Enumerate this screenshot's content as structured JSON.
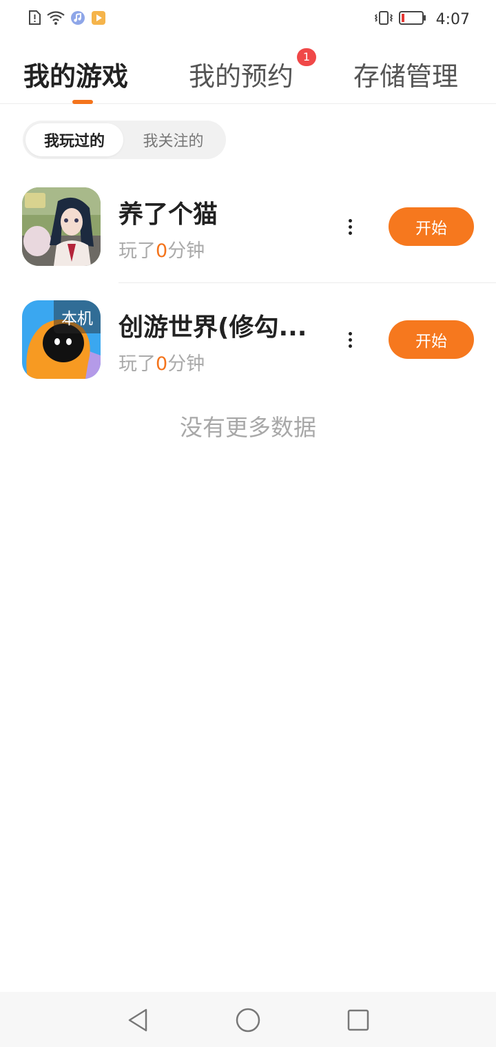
{
  "status_bar": {
    "time": "4:07",
    "left_icons": [
      "sim-alert-icon",
      "wifi-icon",
      "music-app-icon",
      "video-app-icon"
    ],
    "right_icons": [
      "vibrate-icon",
      "battery-low-icon"
    ],
    "battery_color": "#e53935"
  },
  "top_tabs": [
    {
      "label": "我的游戏",
      "active": true
    },
    {
      "label": "我的预约",
      "active": false,
      "badge": "1"
    },
    {
      "label": "存储管理",
      "active": false
    }
  ],
  "segment": {
    "items": [
      {
        "label": "我玩过的",
        "active": true
      },
      {
        "label": "我关注的",
        "active": false
      }
    ]
  },
  "games": [
    {
      "title": "养了个猫",
      "played_prefix": "玩了",
      "played_value": "0",
      "played_unit": "分钟",
      "action_label": "开始",
      "icon": "anime-girl-game-icon"
    },
    {
      "title": "创游世界(修勾...",
      "played_prefix": "玩了",
      "played_value": "0",
      "played_unit": "分钟",
      "action_label": "开始",
      "icon": "creation-world-game-icon",
      "badge": "本机"
    }
  ],
  "footer_text": "没有更多数据",
  "nav_bar": {
    "buttons": [
      "back-icon",
      "home-icon",
      "recents-icon"
    ]
  },
  "colors": {
    "accent": "#f6781e",
    "badge_red": "#f04848",
    "muted_text": "#aaaaaa"
  }
}
